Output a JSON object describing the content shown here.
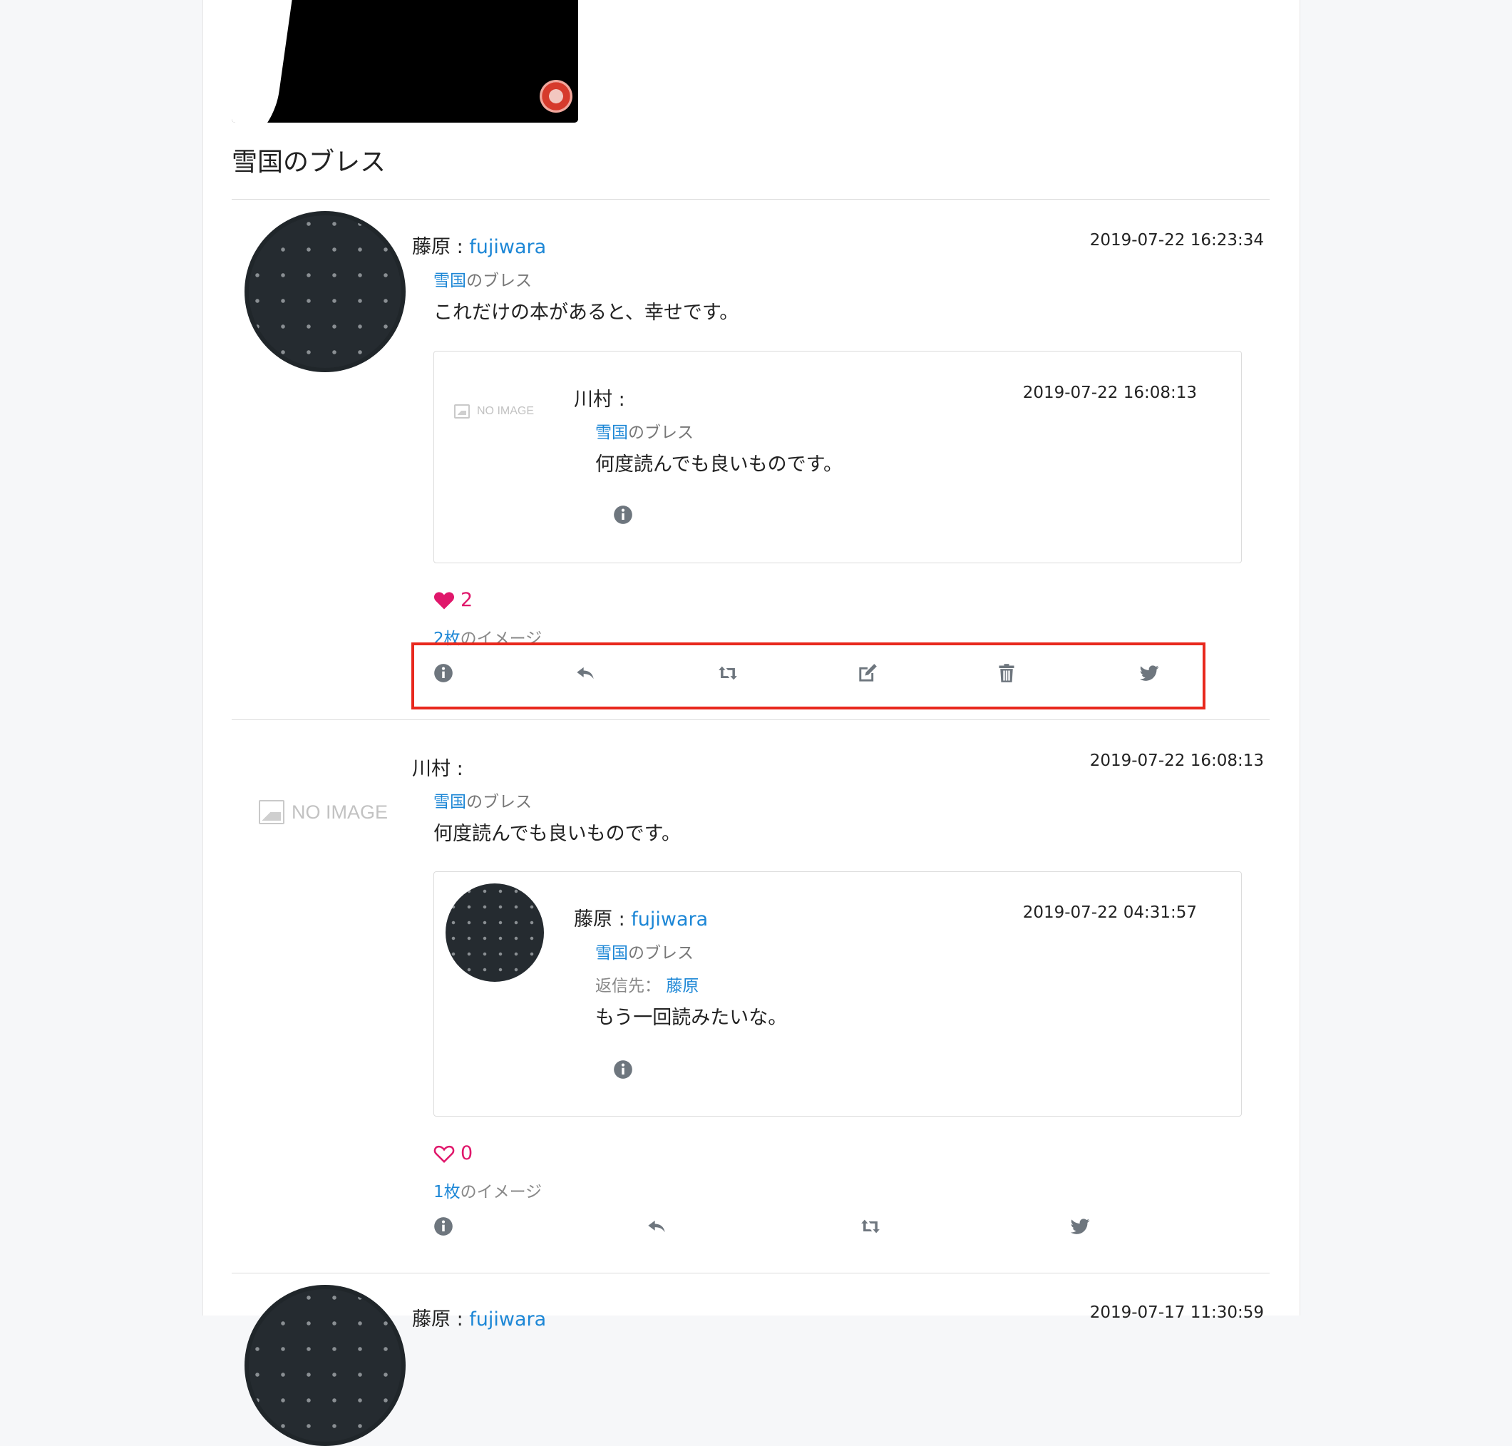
{
  "book": {
    "title": "雪国のブレス"
  },
  "posts": [
    {
      "author": "藤原",
      "separator": " : ",
      "handle": "fujiwara",
      "date": "2019-07-22 16:23:34",
      "book_link": "雪国",
      "book_suffix": "のブレス",
      "text": "これだけの本があると、幸せです。",
      "quote": {
        "avatar_text": "NO IMAGE",
        "author": "川村 :",
        "date": "2019-07-22 16:08:13",
        "book_link": "雪国",
        "book_suffix": "のブレス",
        "text": "何度読んでも良いものです。"
      },
      "likes": "2",
      "images_link": "2枚",
      "images_suffix": "のイメージ"
    },
    {
      "avatar_text": "NO IMAGE",
      "author": "川村 :",
      "date": "2019-07-22 16:08:13",
      "book_link": "雪国",
      "book_suffix": "のブレス",
      "text": "何度読んでも良いものです。",
      "quote": {
        "author": "藤原",
        "separator": " : ",
        "handle": "fujiwara",
        "date": "2019-07-22 04:31:57",
        "book_link": "雪国",
        "book_suffix": "のブレス",
        "reply_label": "返信先：",
        "reply_to": "藤原",
        "text": "もう一回読みたいな。"
      },
      "likes": "0",
      "images_link": "1枚",
      "images_suffix": "のイメージ"
    },
    {
      "author": "藤原",
      "separator": " : ",
      "handle": "fujiwara",
      "date": "2019-07-17 11:30:59"
    }
  ],
  "icons": {
    "info": "info-icon",
    "reply": "reply-icon",
    "retweet": "retweet-icon",
    "edit": "edit-icon",
    "delete": "trash-icon",
    "twitter": "twitter-icon"
  },
  "colors": {
    "link": "#1d87d6",
    "like": "#e0176b",
    "highlight": "#e8281d",
    "icon": "#6e767e"
  }
}
